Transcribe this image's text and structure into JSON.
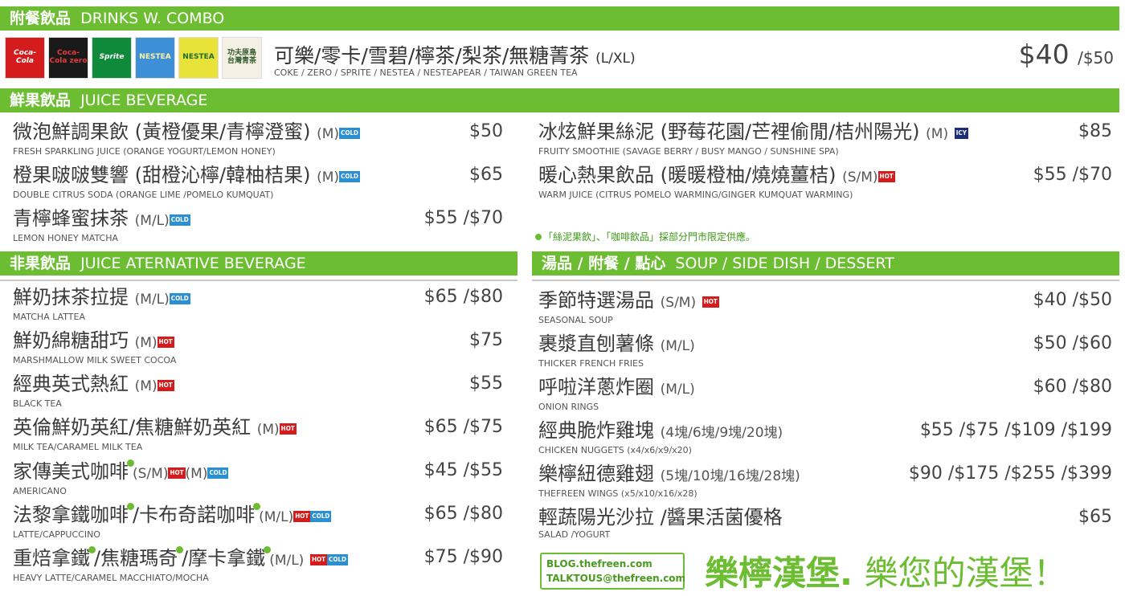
{
  "section_drinks": {
    "cn": "附餐飲品",
    "en": "DRINKS W. COMBO"
  },
  "cans": [
    "Coca-Cola",
    "Coca-Cola zero",
    "Sprite",
    "NESTEA",
    "NESTEA",
    "功夫原島 台灣青茶"
  ],
  "drinks": {
    "title": "可樂/零卡/雪碧/檸茶/梨茶/無糖菁茶",
    "size": "(L/XL)",
    "sub": "COKE / ZERO / SPRITE / NESTEA / NESTEAPEAR / TAIWAN GREEN TEA",
    "price_main": "$40",
    "price_alt": "/$50"
  },
  "section_juice": {
    "cn": "鮮果飲品",
    "en": "JUICE BEVERAGE"
  },
  "juice_left": [
    {
      "name": "微泡鮮調果飲 (黃橙優果/青檸澄蜜)",
      "size": "(M)",
      "tag": "COLD",
      "en": "FRESH SPARKLING JUICE (ORANGE YOGURT/LEMON HONEY)",
      "price": "$50"
    },
    {
      "name": "橙果啵啵雙響 (甜橙沁檸/韓柚桔果)",
      "size": "(M)",
      "tag": "COLD",
      "en": "DOUBLE CITRUS SODA (ORANGE LIME /POMELO KUMQUAT)",
      "price": "$65"
    },
    {
      "name": "青檸蜂蜜抹茶",
      "size": "(M/L)",
      "tag": "COLD",
      "en": "LEMON HONEY MATCHA",
      "price": "$55 /$70"
    }
  ],
  "juice_right": [
    {
      "name": "冰炫鮮果絲泥 (野莓花園/芒裡偷閒/桔州陽光)",
      "size": "(M)",
      "tag": "ICY",
      "en": "FRUITY SMOOTHIE (SAVAGE BERRY / BUSY MANGO / SUNSHINE SPA)",
      "price": "$85"
    },
    {
      "name": "暖心熱果飲品 (暖暖橙柚/燒燒薑桔)",
      "size": "(S/M)",
      "tag": "HOT",
      "en": "WARM JUICE (CITRUS POMELO WARMING/GINGER  KUMQUAT WARMING)",
      "price": "$55 /$70"
    }
  ],
  "note": "「絲泥果飲」、「咖啡飲品」採部分門市限定供應。",
  "section_nonjuice": {
    "cn": "非果飲品",
    "en": "JUICE ATERNATIVE BEVERAGE"
  },
  "nonjuice": [
    {
      "name": "鮮奶抹茶拉提",
      "size": "(M/L)",
      "tag": "COLD",
      "en": "MATCHA LATTEA",
      "price": "$65 /$80"
    },
    {
      "name": "鮮奶綿糖甜巧",
      "size": "(M)",
      "tag": "HOT",
      "en": "MARSHMALLOW MILK SWEET COCOA",
      "price": "$75"
    },
    {
      "name": "經典英式熱紅",
      "size": "(M)",
      "tag": "HOT",
      "en": "BLACK TEA",
      "price": "$55"
    },
    {
      "name": "英倫鮮奶英紅/焦糖鮮奶英紅",
      "size": "(M)",
      "tag": "HOT",
      "en": "MILK TEA/CARAMEL MILK TEA",
      "price": "$65 /$75"
    },
    {
      "name": "家傳美式咖啡",
      "size": "(S/M)",
      "tag": "HOT",
      "size2": "(M)",
      "tag2": "COLD",
      "en": "AMERICANO",
      "price": "$45 /$55"
    },
    {
      "name": "法黎拿鐵咖啡",
      "name2": "/卡布奇諾咖啡",
      "size": "(M/L)",
      "tag": "HOT",
      "tag2": "COLD",
      "en": "LATTE/CAPPUCCINO",
      "price": "$65 /$80"
    },
    {
      "name": "重焙拿鐵",
      "name2": "/焦糖瑪奇",
      "name3": "/摩卡拿鐵",
      "size": "(M/L)",
      "tag": "HOT",
      "tag2": "COLD",
      "en": "HEAVY LATTE/CARAMEL MACCHIATO/MOCHA",
      "price": "$75 /$90"
    }
  ],
  "section_soup": {
    "cn": "湯品 / 附餐 / 點心",
    "en": "SOUP / SIDE DISH / DESSERT"
  },
  "soup": [
    {
      "name": "季節特選湯品",
      "size": "(S/M)",
      "tag": "HOT",
      "en": "SEASONAL SOUP",
      "price": "$40 /$50"
    },
    {
      "name": "裹漿直刨薯條",
      "size": "(M/L)",
      "en": "THICKER FRENCH FRIES",
      "price": "$50 /$60"
    },
    {
      "name": "呼啦洋蔥炸圈",
      "size": "(M/L)",
      "en": "ONION RINGS",
      "price": "$60 /$80"
    },
    {
      "name": "經典脆炸雞塊",
      "size": "(4塊/6塊/9塊/20塊)",
      "en": "CHICKEN NUGGETS (x4/x6/x9/x20)",
      "price": "$55 /$75 /$109 /$199"
    },
    {
      "name": "樂檸紐德雞翅",
      "size": "(5塊/10塊/16塊/28塊)",
      "en": "THEFREEN WINGS (x5/x10/x16/x28)",
      "price": "$90 /$175 /$255 /$399"
    },
    {
      "name": "輕蔬陽光沙拉 /醬果活菌優格",
      "en": "SALAD /YOGURT",
      "price": "$65"
    }
  ],
  "footer": {
    "blog": "BLOG.thefreen.com",
    "talk": "TALKTOUS@thefreen.com",
    "slogan1": "樂檸漢堡.",
    "slogan2": "樂您的漢堡！"
  },
  "colors": {
    "brand_green": "#6cbd31",
    "cold": "#2b8fd4",
    "hot": "#d41c1c",
    "icy": "#1c2e7a"
  }
}
